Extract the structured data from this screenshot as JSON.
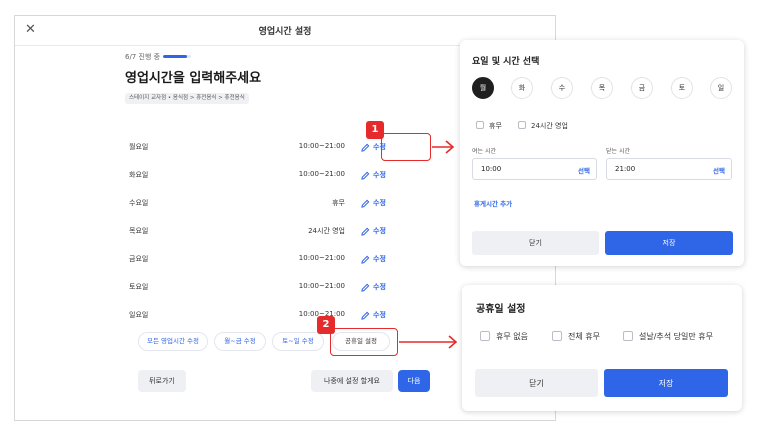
{
  "main_modal": {
    "title": "영업시간 설정",
    "close_glyph": "✕",
    "progress_text": "6/7 진행 중",
    "progress_value": 0.86,
    "page_title": "영업시간을 입력해주세요",
    "breadcrumb": "스테이지 교자점 • 음식점 > 휴전음식 > 휴전음식",
    "days": [
      {
        "name": "월요일",
        "value": "10:00~21:00",
        "edit_label": "수정"
      },
      {
        "name": "화요일",
        "value": "10:00~21:00",
        "edit_label": "수정"
      },
      {
        "name": "수요일",
        "value": "휴무",
        "edit_label": "수정"
      },
      {
        "name": "목요일",
        "value": "24시간 영업",
        "edit_label": "수정"
      },
      {
        "name": "금요일",
        "value": "10:00~21:00",
        "edit_label": "수정"
      },
      {
        "name": "토요일",
        "value": "10:00~21:00",
        "edit_label": "수정"
      },
      {
        "name": "일요일",
        "value": "10:00~21:00",
        "edit_label": "수정"
      }
    ],
    "chips": {
      "all_edit": "모든 영업시간 수정",
      "weekday_edit": "월~금 수정",
      "weekend_edit": "토~일 수정",
      "holiday_setting": "공휴일 설정"
    },
    "back_label": "뒤로가기",
    "later_label": "나중에 설정 할게요",
    "next_label": "다음"
  },
  "annotations": {
    "badge1": "1",
    "badge2": "2",
    "color": "#e52b2b"
  },
  "day_time_panel": {
    "title": "요일 및 시간 선택",
    "weekdays": [
      "월",
      "화",
      "수",
      "목",
      "금",
      "토",
      "일"
    ],
    "active_weekday": "월",
    "off_label": "휴무",
    "allday_label": "24시간 영업",
    "open_label": "여는 시간",
    "open_value": "10:00",
    "close_label": "닫는 시간",
    "close_value": "21:00",
    "select_label": "선택",
    "add_break_label": "휴게시간 추가",
    "cancel_label": "닫기",
    "save_label": "저장"
  },
  "holiday_panel": {
    "title": "공휴일 설정",
    "options": [
      "휴무 없음",
      "전체 휴무",
      "설날/추석 당일만 휴무"
    ],
    "cancel_label": "닫기",
    "save_label": "저장"
  },
  "colors": {
    "accent": "#2f66e8",
    "annotation": "#e52b2b",
    "dark_selected": "#1f1f1f"
  }
}
